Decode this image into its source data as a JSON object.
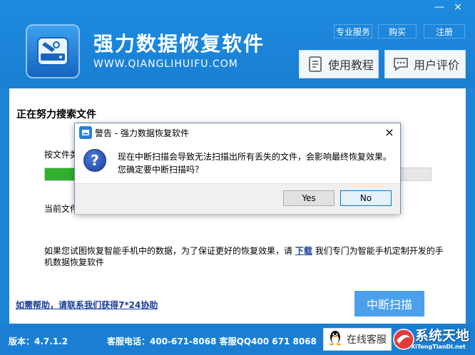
{
  "window": {
    "minimize": "—",
    "close": "×"
  },
  "header": {
    "title": "强力数据恢复软件",
    "url": "WWW.QIANGLIHUIFU.COM",
    "links": {
      "service": "专业服务",
      "buy": "购买",
      "register": "注册"
    },
    "tutorial_label": "使用教程",
    "review_label": "用户评价"
  },
  "content": {
    "status_title": "正在努力搜索文件",
    "by_type_label": "按文件类",
    "progress": 0.12,
    "current_file_label": "当前文件",
    "info_text_before": "如果您试图恢复智能手机中的数据，为了保证更好的恢复效果，请",
    "info_link": "下载",
    "info_text_after": "我们专门为智能手机定制开发的手机数据恢复软件",
    "help_link": "如需帮助，请联系我们获得7*24协助",
    "stop_button": "中断扫描"
  },
  "footer": {
    "version": "版本：4.7.1.2",
    "phone": "客服电话：400-671-8068 客服QQ400 671 8068",
    "online_label": "在线客服"
  },
  "watermark": {
    "main": "系统天地",
    "sub": "XiTongTianDi.net"
  },
  "dialog": {
    "title": "警告 - 强力数据恢复软件",
    "close": "×",
    "line1": "现在中断扫描会导致无法扫描出所有丢失的文件，会影响最终恢复效果。",
    "line2": "您确定要中断扫描吗？",
    "icon_glyph": "?",
    "yes_label": "Yes",
    "no_label": "No"
  },
  "colors": {
    "brand_blue": "#1e84d8",
    "progress_green": "#2fb12f",
    "link_blue": "#1a3f9a"
  }
}
